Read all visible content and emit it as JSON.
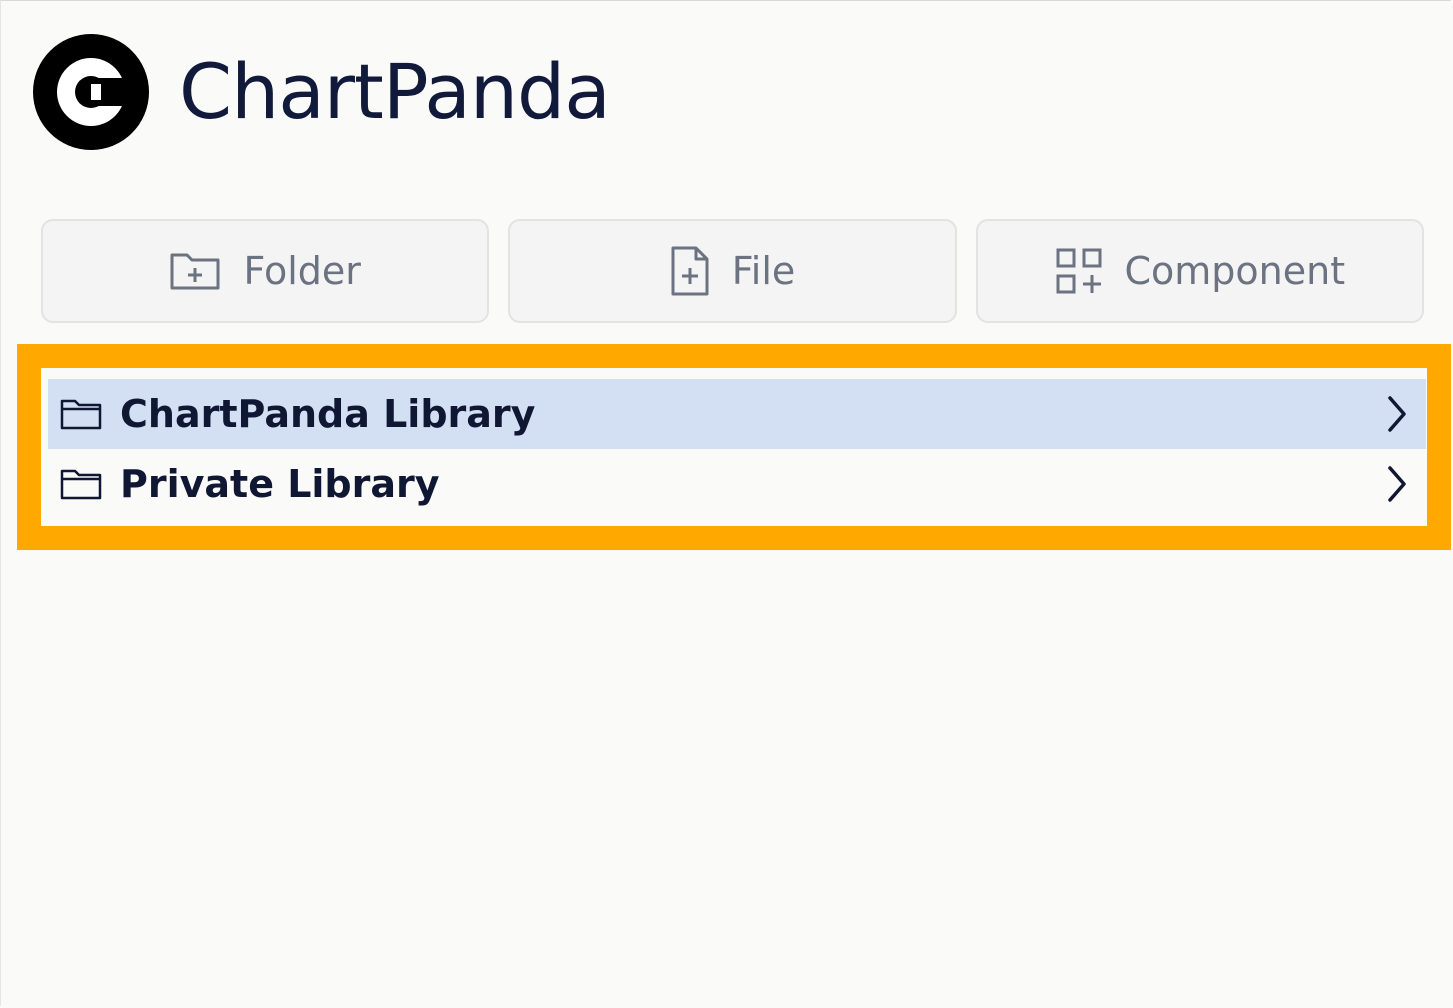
{
  "app": {
    "title": "ChartPanda",
    "brand_color": "#111a3a"
  },
  "toolbar": {
    "buttons": [
      {
        "label": "Folder",
        "icon": "folder-plus-icon"
      },
      {
        "label": "File",
        "icon": "file-plus-icon"
      },
      {
        "label": "Component",
        "icon": "component-plus-icon"
      }
    ]
  },
  "tree": {
    "highlight_color": "#ffa800",
    "items": [
      {
        "label": "ChartPanda Library",
        "icon": "folder-icon",
        "selected": true
      },
      {
        "label": "Private Library",
        "icon": "folder-icon",
        "selected": false
      }
    ]
  }
}
